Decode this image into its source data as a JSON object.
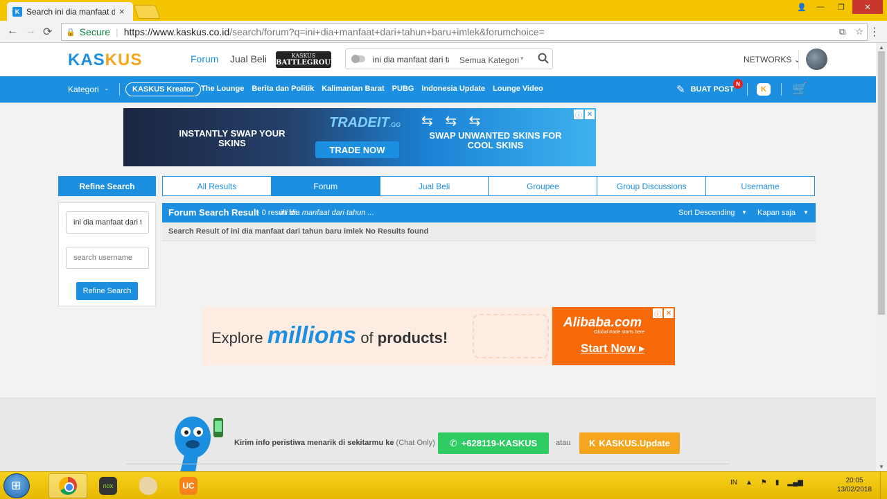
{
  "browser": {
    "tab_title": "Search ini dia manfaat dari tahun baru imlek",
    "tab_favicon": "K",
    "tab_close": "×",
    "secure_label": "Secure",
    "url_host": "https://www.kaskus.co.id",
    "url_path": "/search/forum?q=ini+dia+manfaat+dari+tahun+baru+imlek&forumchoice=",
    "window_buttons": {
      "minimize": "—",
      "maximize": "❐",
      "close": "✕",
      "user": "👤"
    },
    "nav": {
      "back": "←",
      "forward": "→",
      "reload": "⟳",
      "translate": "⧉",
      "star": "☆",
      "menu": "⋮"
    }
  },
  "header": {
    "logo_part1": "KAS",
    "logo_part2": "KUS",
    "menu_forum": "Forum",
    "menu_jualbeli": "Jual Beli",
    "battleground_line1": "KASKUS",
    "battleground_line2": "BATTLEGROUND",
    "search_query": "ini dia manfaat dari tahun baru imlek",
    "search_category": "Semua Kategori",
    "networks": "NETWORKS"
  },
  "navbar": {
    "kategori": "Kategori",
    "kreator": "KASKUS Kreator",
    "links": [
      "The Lounge",
      "Berita dan Politik",
      "Kalimantan Barat",
      "PUBG",
      "Indonesia Update",
      "Lounge Video"
    ],
    "buat_post": "BUAT POST",
    "badge": "N",
    "kicon": "K",
    "pencil_icon": "✎",
    "cart_icon": "🛒"
  },
  "ad_top": {
    "left_text": "INSTANTLY SWAP YOUR SKINS",
    "logo": "TRADEIT",
    "logo_suffix": ".GG",
    "button": "TRADE NOW",
    "right_text": "SWAP UNWANTED SKINS FOR COOL SKINS",
    "arrows": "⇆ ⇆ ⇆",
    "info": "ⓘ",
    "close": "✕"
  },
  "refine": {
    "title": "Refine Search",
    "query_value": "ini dia manfaat dari tahun baru imlek",
    "username_placeholder": "search username",
    "button": "Refine Search"
  },
  "tabs": [
    {
      "label": "All Results",
      "active": false
    },
    {
      "label": "Forum",
      "active": true
    },
    {
      "label": "Jual Beli",
      "active": false
    },
    {
      "label": "Groupee",
      "active": false
    },
    {
      "label": "Group Discussions",
      "active": false
    },
    {
      "label": "Username",
      "active": false
    }
  ],
  "results": {
    "title": "Forum Search Result",
    "count_text": "- 0 result for",
    "query_text": "ini dia manfaat dari tahun ...",
    "sort": "Sort Descending",
    "time": "Kapan saja",
    "message": "Search Result of ini dia manfaat dari tahun baru imlek No Results found"
  },
  "ad_bottom": {
    "explore": "Explore",
    "millions": "millions",
    "of": "of",
    "products": "products!",
    "logo": "Alibaba.com",
    "tagline": "Global trade starts here",
    "start": "Start Now ▸",
    "info": "ⓘ",
    "close": "✕"
  },
  "footer": {
    "info_text": "Kirim info peristiwa menarik di sekitarmu ke",
    "chat_only": "(Chat Only)",
    "whatsapp": "+628119-KASKUS",
    "atau": "atau",
    "kaskus_update": "KASKUS.Update"
  },
  "taskbar": {
    "lang": "IN",
    "time": "20:05",
    "date": "13/02/2018"
  },
  "colors": {
    "kaskus_blue": "#1d8fe1",
    "kaskus_orange": "#f7a51c",
    "titlebar_yellow": "#f5c400",
    "whatsapp_green": "#2ecc62",
    "alibaba_orange": "#f66a0a"
  }
}
